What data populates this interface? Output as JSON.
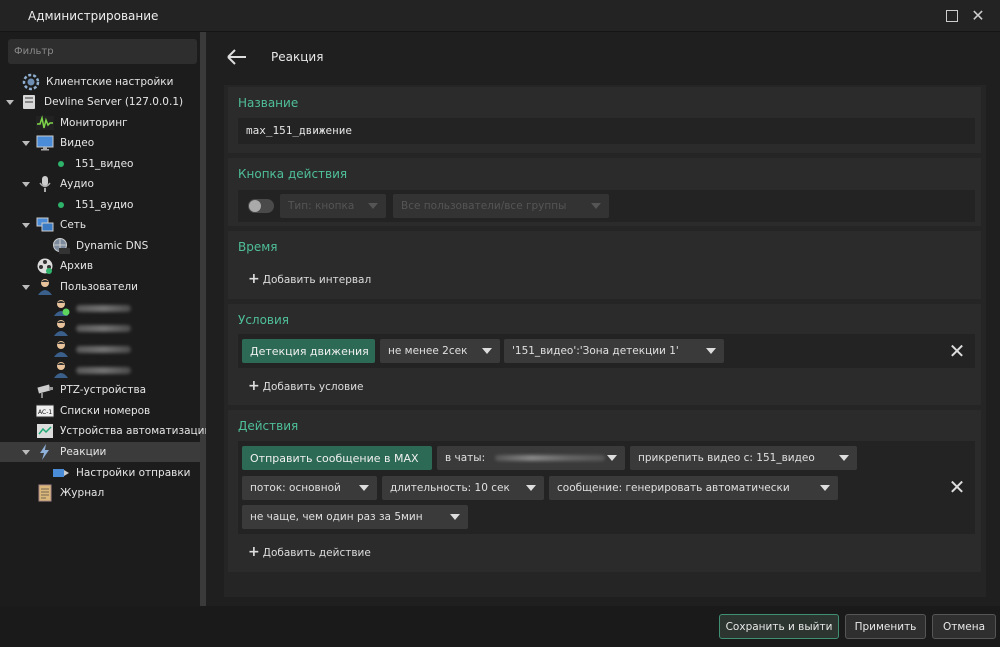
{
  "window": {
    "title": "Администрирование"
  },
  "sidebar": {
    "filter_placeholder": "Фильтр",
    "tree": [
      {
        "label": "Клиентские настройки",
        "icon": "gear-icon"
      },
      {
        "label": "Devline Server (127.0.0.1)",
        "icon": "server-icon"
      },
      {
        "label": "Мониторинг",
        "icon": "monitoring-icon"
      },
      {
        "label": "Видео",
        "icon": "monitor-icon"
      },
      {
        "label": "151_видео",
        "icon": "status-dot"
      },
      {
        "label": "Аудио",
        "icon": "microphone-icon"
      },
      {
        "label": "151_аудио",
        "icon": "status-dot"
      },
      {
        "label": "Сеть",
        "icon": "network-icon"
      },
      {
        "label": "Dynamic DNS",
        "icon": "dns-globe-icon"
      },
      {
        "label": "Архив",
        "icon": "film-reel-icon"
      },
      {
        "label": "Пользователи",
        "icon": "users-icon"
      },
      {
        "label": "PTZ-устройства",
        "icon": "ptz-camera-icon"
      },
      {
        "label": "Списки номеров",
        "icon": "license-plate-icon"
      },
      {
        "label": "Устройства автоматизации",
        "icon": "automation-icon"
      },
      {
        "label": "Реакции",
        "icon": "lightning-icon"
      },
      {
        "label": "Настройки отправки",
        "icon": "send-icon"
      },
      {
        "label": "Журнал",
        "icon": "journal-icon"
      }
    ]
  },
  "main": {
    "title": "Реакция",
    "name_section": {
      "title": "Название",
      "value": "max_151_движение"
    },
    "action_button_section": {
      "title": "Кнопка действия",
      "type_select": "Тип: кнопка",
      "users_select": "Все пользователи/все группы"
    },
    "time_section": {
      "title": "Время",
      "add_label": "Добавить интервал"
    },
    "conditions_section": {
      "title": "Условия",
      "condition": "Детекция движения",
      "duration": "не менее 2сек",
      "zone": "'151_видео':'Зона детекции 1'",
      "add_label": "Добавить условие"
    },
    "actions_section": {
      "title": "Действия",
      "action": "Отправить сообщение в MAX",
      "chats": "в чаты:",
      "attach": "прикрепить видео с: 151_видео",
      "stream": "поток: основной",
      "duration": "длительность: 10 сек",
      "message": "сообщение: генерировать автоматически",
      "frequency": "не чаще, чем один раз за 5мин",
      "add_label": "Добавить действие"
    }
  },
  "footer": {
    "save_exit": "Сохранить и выйти",
    "apply": "Применить",
    "cancel": "Отмена"
  },
  "colors": {
    "accent": "#4fbf9a",
    "green_chip": "#2d6a55",
    "status_dot": "#2fb36b"
  }
}
